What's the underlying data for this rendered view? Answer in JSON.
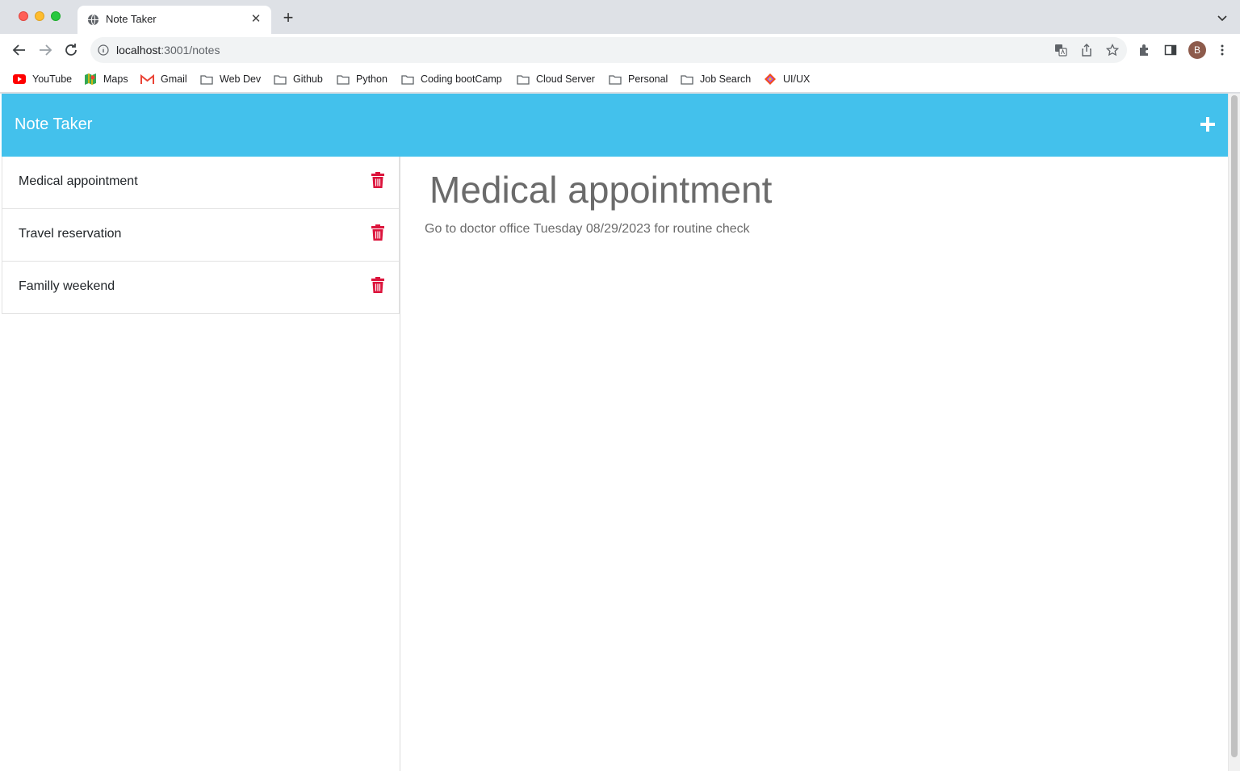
{
  "browser": {
    "tab_title": "Note Taker",
    "url_host": "localhost",
    "url_path": ":3001/notes",
    "profile_initial": "B",
    "bookmarks": [
      {
        "label": "YouTube",
        "icon": "youtube-icon"
      },
      {
        "label": "Maps",
        "icon": "maps-icon"
      },
      {
        "label": "Gmail",
        "icon": "gmail-icon"
      },
      {
        "label": "Web Dev",
        "icon": "folder-icon"
      },
      {
        "label": "Github",
        "icon": "folder-icon"
      },
      {
        "label": "Python",
        "icon": "folder-icon"
      },
      {
        "label": "Coding bootCamp",
        "icon": "folder-icon"
      },
      {
        "label": "Cloud Server",
        "icon": "folder-icon"
      },
      {
        "label": "Personal",
        "icon": "folder-icon"
      },
      {
        "label": "Job Search",
        "icon": "folder-icon"
      },
      {
        "label": "UI/UX",
        "icon": "figma-diamond-icon"
      }
    ]
  },
  "app": {
    "title": "Note Taker",
    "header_color": "#43c1ec",
    "delete_color": "#dc143c",
    "notes": [
      {
        "title": "Medical appointment"
      },
      {
        "title": "Travel reservation"
      },
      {
        "title": "Familly weekend"
      }
    ],
    "active_note": {
      "title": "Medical appointment",
      "text": "Go to doctor office Tuesday 08/29/2023 for routine check"
    }
  }
}
